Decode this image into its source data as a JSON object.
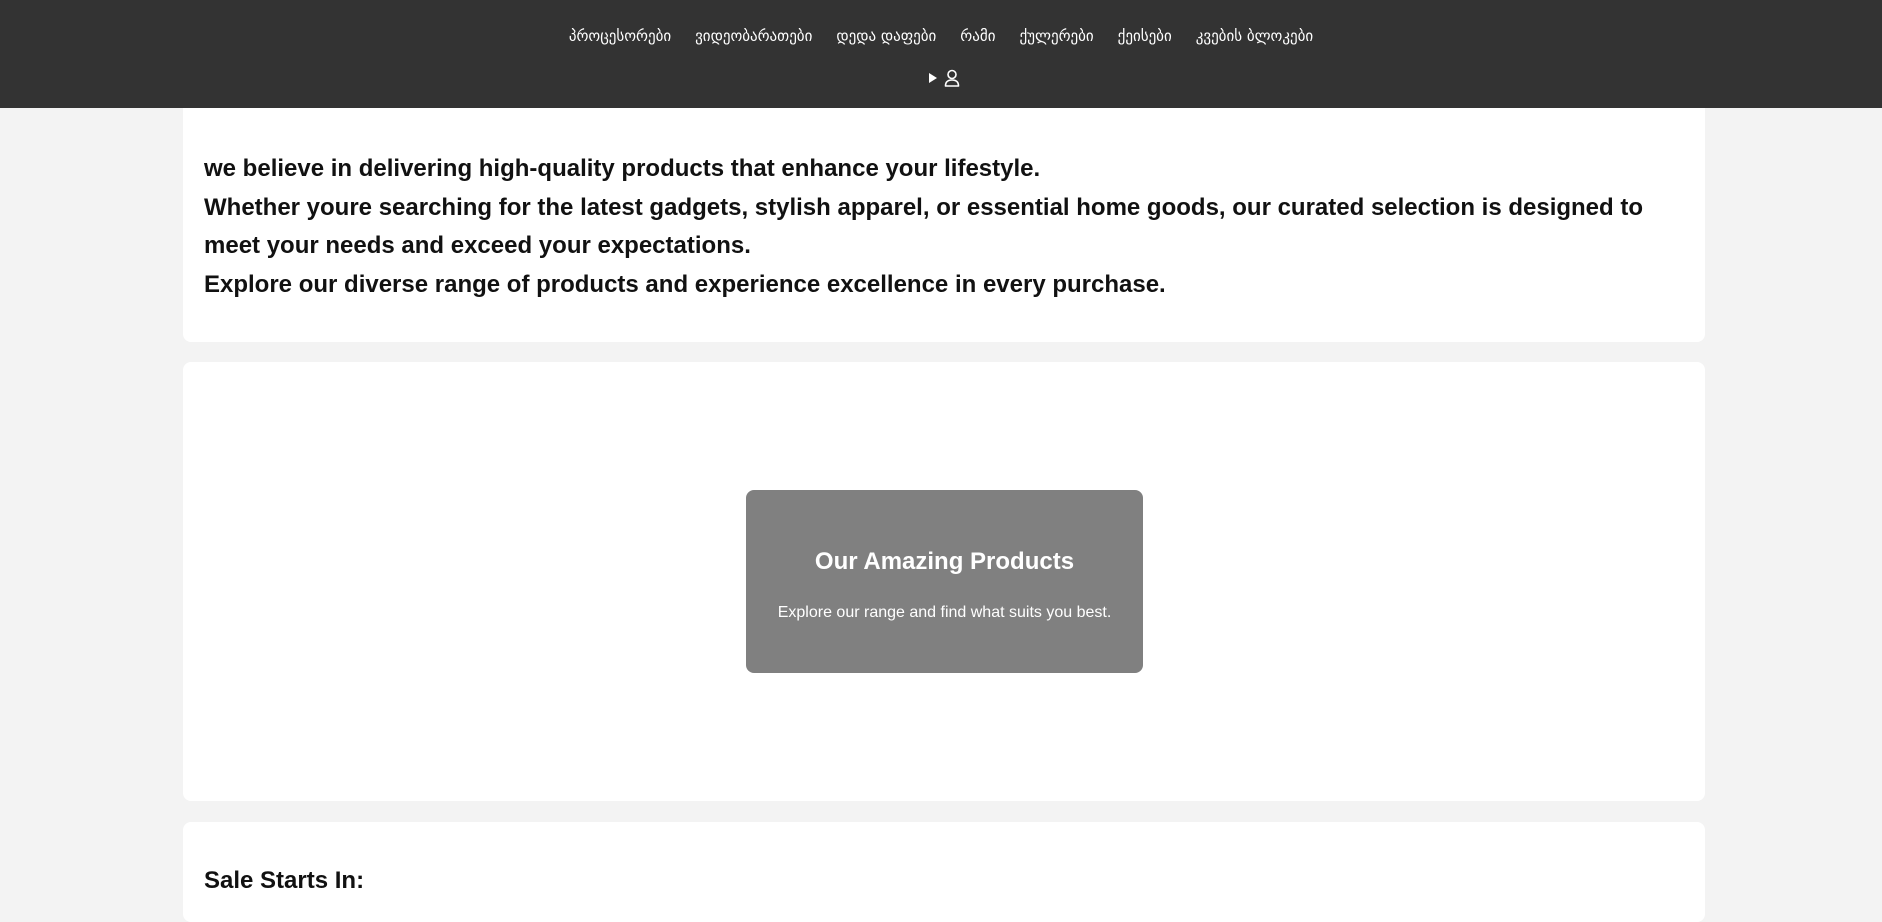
{
  "nav": {
    "items": [
      {
        "label": "პროცესორები"
      },
      {
        "label": "ვიდეობარათები"
      },
      {
        "label": "დედა დაფები"
      },
      {
        "label": "რამი"
      },
      {
        "label": "ქულერები"
      },
      {
        "label": "ქეისები"
      },
      {
        "label": "კვების ბლოკები"
      }
    ],
    "icons": [
      "play-icon",
      "user-icon"
    ],
    "background": "#333333"
  },
  "intro": {
    "lines": [
      "we believe in delivering high-quality products that enhance your lifestyle.",
      "Whether youre searching for the latest gadgets, stylish apparel, or essential home goods, our curated selection is designed to meet your needs and exceed your expectations.",
      "Explore our diverse range of products and experience excellence in every purchase."
    ]
  },
  "hero": {
    "title": "Our Amazing Products",
    "subtitle": "Explore our range and find what suits you best.",
    "background": "#808080"
  },
  "sale": {
    "title": "Sale Starts In:"
  }
}
